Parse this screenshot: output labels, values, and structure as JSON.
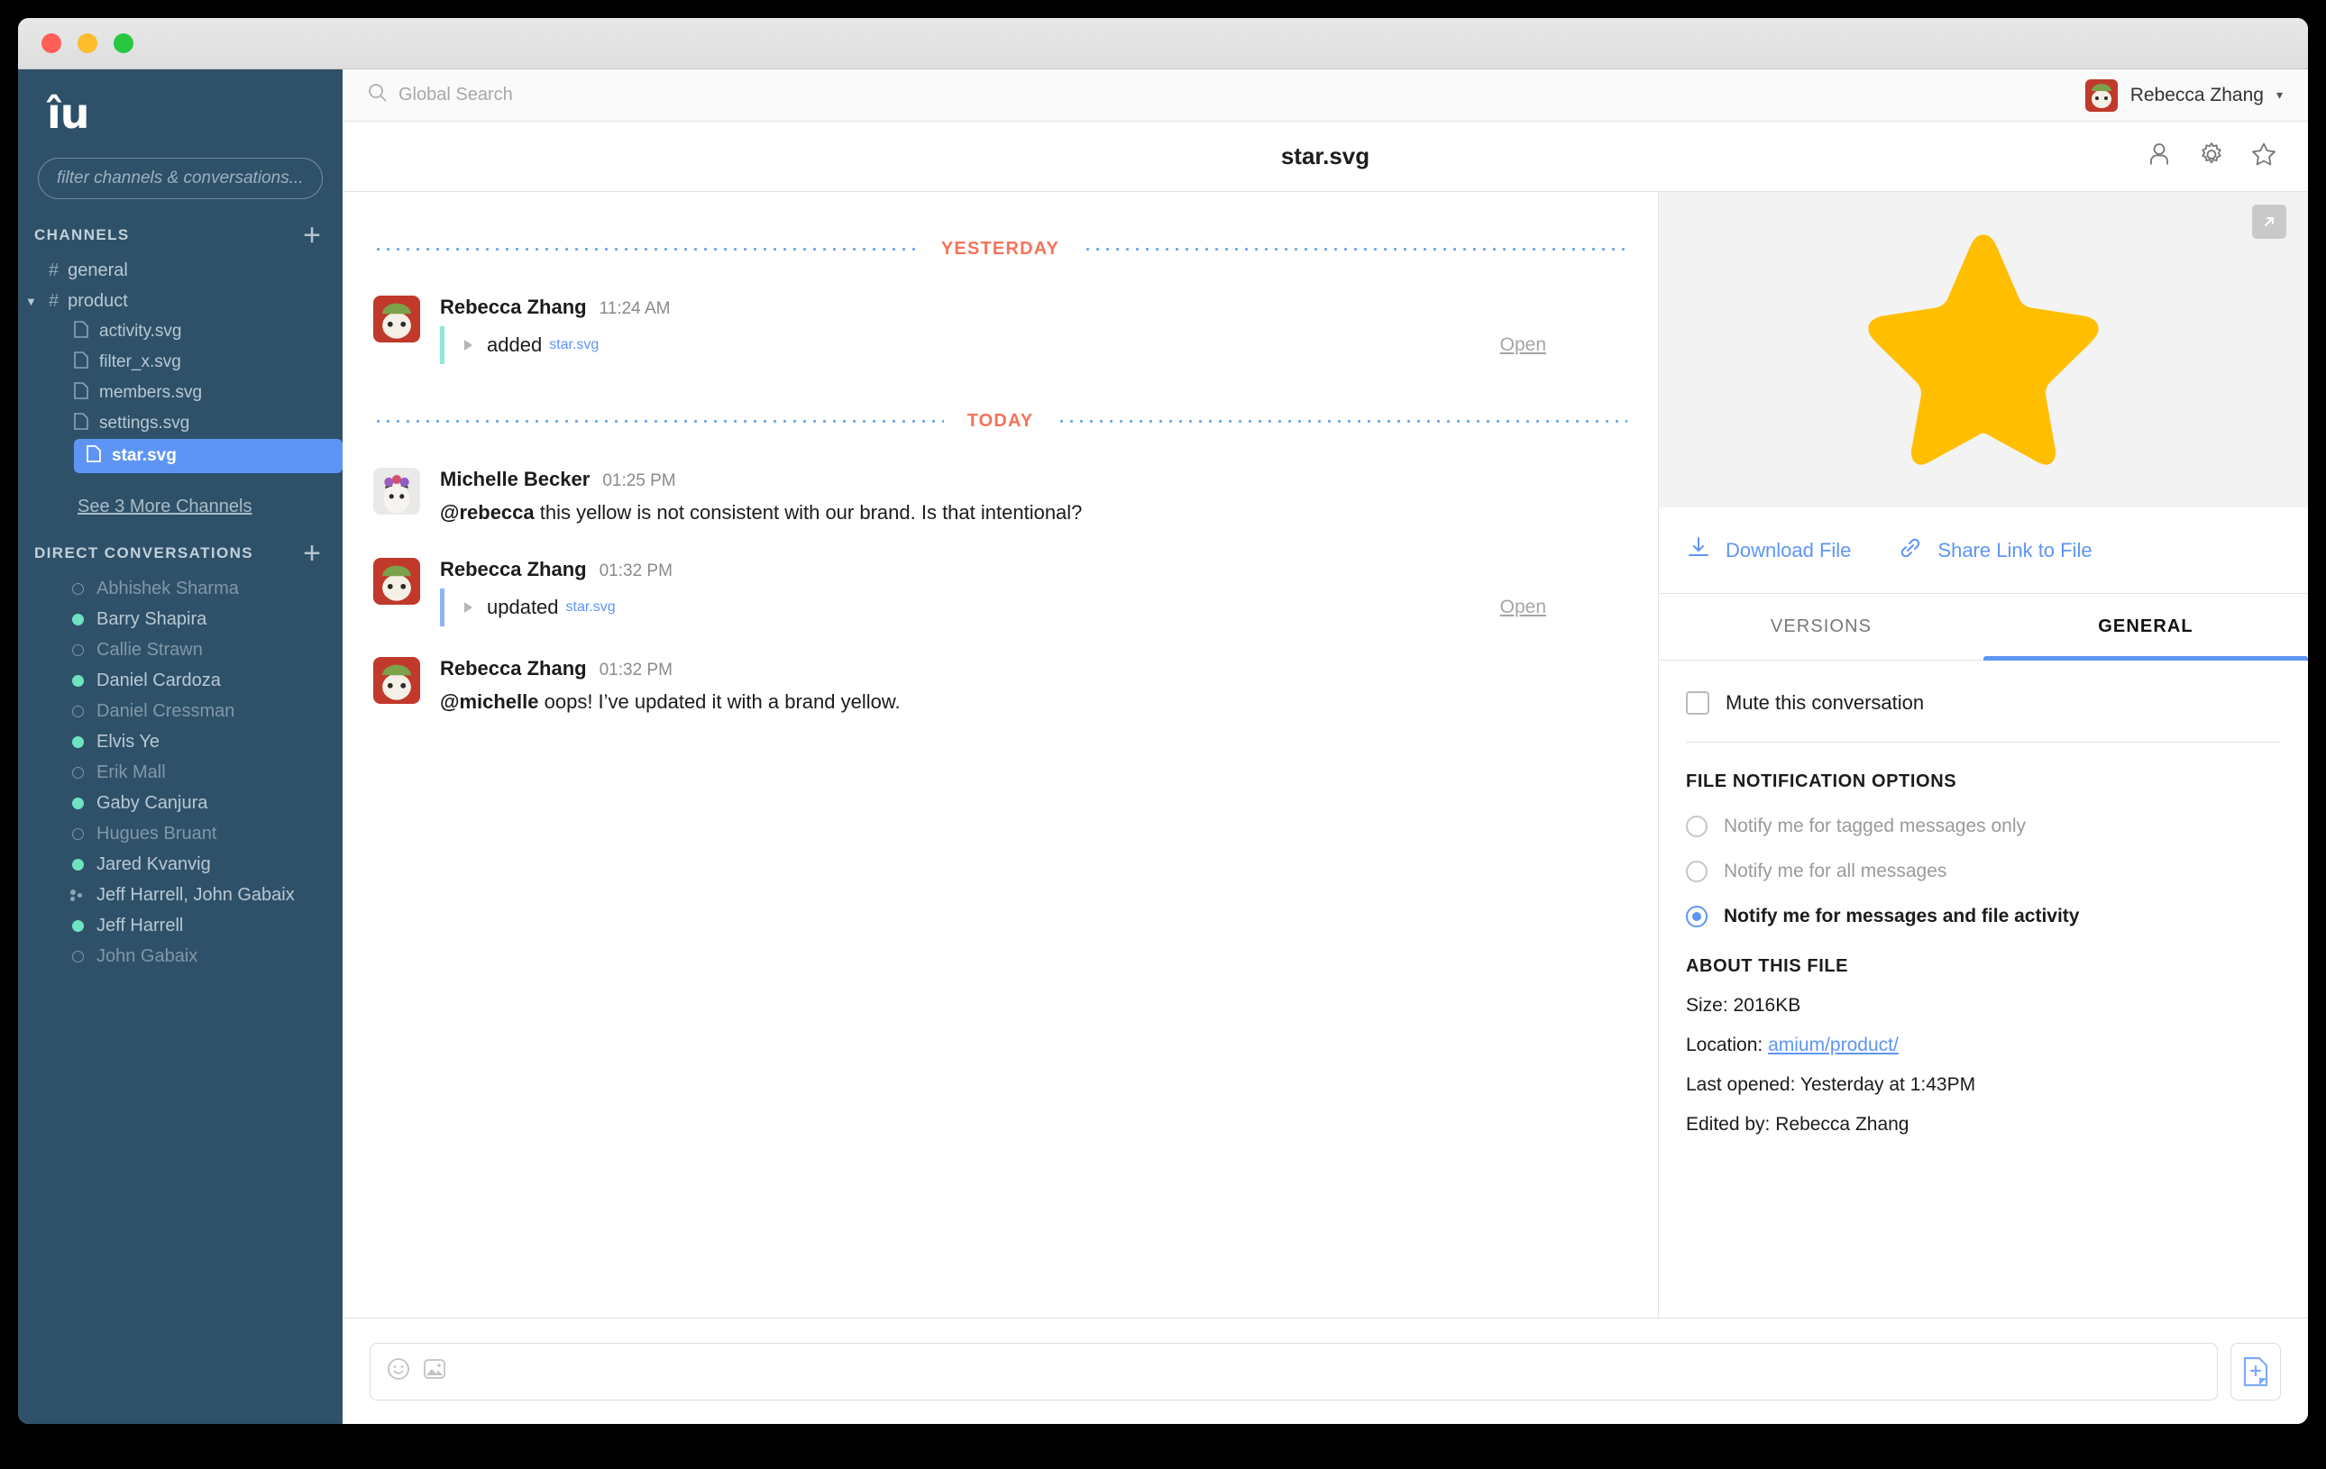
{
  "window": {
    "traffic_lights": [
      "close",
      "minimize",
      "maximize"
    ]
  },
  "sidebar": {
    "logo": "îu",
    "filter": {
      "placeholder": "filter channels & conversations...",
      "value": ""
    },
    "channels_header": "CHANNELS",
    "channels": [
      {
        "name": "general",
        "type": "channel",
        "expanded": false,
        "selected": false
      },
      {
        "name": "product",
        "type": "channel",
        "expanded": true,
        "selected": false
      },
      {
        "name": "activity.svg",
        "type": "file",
        "selected": false
      },
      {
        "name": "filter_x.svg",
        "type": "file",
        "selected": false
      },
      {
        "name": "members.svg",
        "type": "file",
        "selected": false
      },
      {
        "name": "settings.svg",
        "type": "file",
        "selected": false
      },
      {
        "name": "star.svg",
        "type": "file",
        "selected": true
      }
    ],
    "see_more": "See 3 More Channels",
    "dm_header": "DIRECT CONVERSATIONS",
    "conversations": [
      {
        "name": "Abhishek Sharma",
        "presence": "offline"
      },
      {
        "name": "Barry Shapira",
        "presence": "online"
      },
      {
        "name": "Callie Strawn",
        "presence": "offline"
      },
      {
        "name": "Daniel Cardoza",
        "presence": "online"
      },
      {
        "name": "Daniel Cressman",
        "presence": "offline"
      },
      {
        "name": "Elvis Ye",
        "presence": "online"
      },
      {
        "name": "Erik Mall",
        "presence": "offline"
      },
      {
        "name": "Gaby Canjura",
        "presence": "online"
      },
      {
        "name": "Hugues Bruant",
        "presence": "offline"
      },
      {
        "name": "Jared Kvanvig",
        "presence": "online"
      },
      {
        "name": "Jeff Harrell, John Gabaix",
        "presence": "group"
      },
      {
        "name": "Jeff Harrell",
        "presence": "online"
      },
      {
        "name": "John Gabaix",
        "presence": "offline"
      }
    ],
    "add_channel_label": "+",
    "add_dm_label": "+"
  },
  "topbar": {
    "search_placeholder": "Global Search",
    "search_value": "",
    "user_name": "Rebecca Zhang",
    "chevron": "▾"
  },
  "subbar": {
    "title": "star.svg",
    "icons": [
      "person-icon",
      "gear-icon",
      "star-icon"
    ]
  },
  "conversation": {
    "groups": [
      {
        "separator": "YESTERDAY",
        "messages": [
          {
            "kind": "event",
            "author": "Rebecca Zhang",
            "time": "11:24 AM",
            "verb": "added",
            "file": "star.svg",
            "open_label": "Open",
            "accent": "teal"
          }
        ]
      },
      {
        "separator": "TODAY",
        "messages": [
          {
            "kind": "text",
            "author": "Michelle Becker",
            "time": "01:25 PM",
            "mention": "@rebecca",
            "text": " this yellow is not consistent with our brand. Is that intentional?"
          },
          {
            "kind": "event",
            "author": "Rebecca Zhang",
            "time": "01:32 PM",
            "verb": "updated",
            "file": "star.svg",
            "open_label": "Open",
            "accent": "blue"
          },
          {
            "kind": "text",
            "author": "Rebecca Zhang",
            "time": "01:32 PM",
            "mention": "@michelle",
            "text": " oops! I’ve updated it with a brand yellow."
          }
        ]
      }
    ]
  },
  "right_panel": {
    "preview": {
      "image": "star-shape",
      "color": "#FFBF00",
      "expand_icon": "expand-arrow-icon"
    },
    "download_label": "Download File",
    "share_label": "Share Link to File",
    "tabs": [
      {
        "label": "VERSIONS",
        "active": false
      },
      {
        "label": "GENERAL",
        "active": true
      }
    ],
    "mute_label": "Mute this conversation",
    "mute_checked": false,
    "notification_section_title": "FILE NOTIFICATION OPTIONS",
    "notification_options": [
      {
        "label": "Notify me for tagged messages only",
        "selected": false
      },
      {
        "label": "Notify me for all messages",
        "selected": false
      },
      {
        "label": "Notify me for messages and file activity",
        "selected": true
      }
    ],
    "about_title": "ABOUT THIS FILE",
    "about": {
      "size_label": "Size: 2016KB",
      "location_prefix": "Location: ",
      "location_link": "amium/product/",
      "last_opened": "Last opened: Yesterday at 1:43PM",
      "edited_by": "Edited by: Rebecca Zhang"
    }
  },
  "composer": {
    "placeholder": "",
    "value": "",
    "emoji_icon": "smiley-icon",
    "image_icon": "image-icon",
    "send_icon": "add-file-icon"
  },
  "colors": {
    "sidebar_bg": "#2e5169",
    "accent_blue": "#5e95f5",
    "star_yellow": "#FFBF00",
    "online_green": "#6fe3c0",
    "day_sep": "#f4735a"
  }
}
